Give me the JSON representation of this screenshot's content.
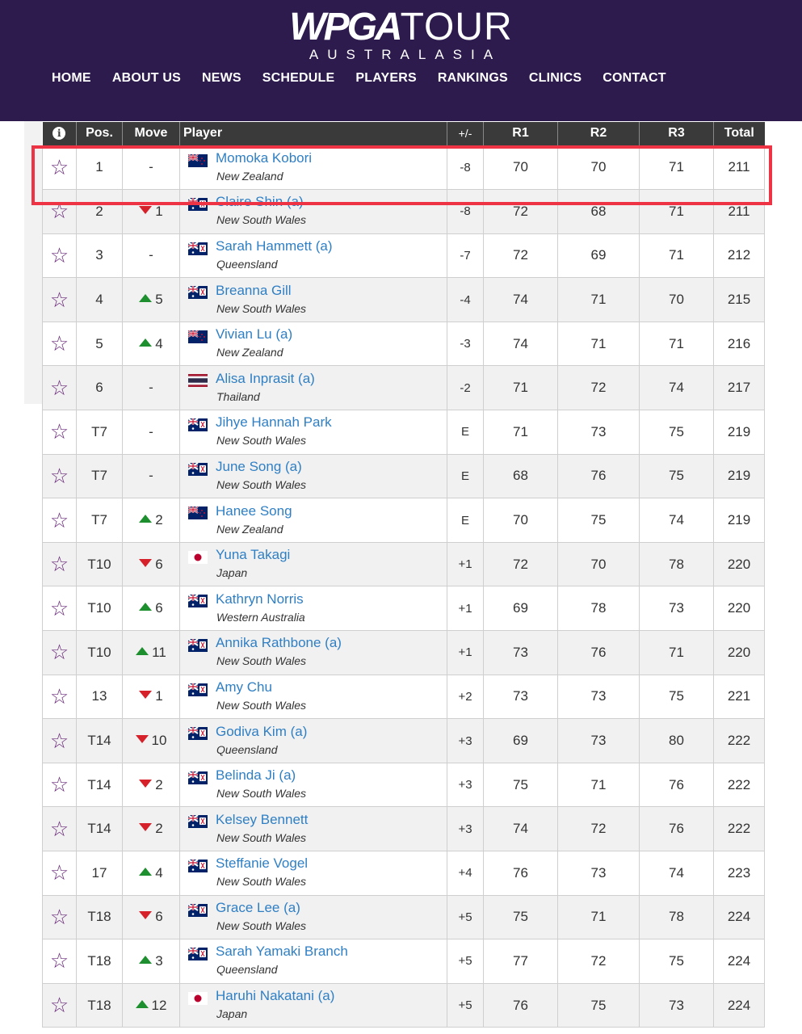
{
  "logo": {
    "bold": "WPGA",
    "thin": "TOUR",
    "sub": "AUSTRALASIA"
  },
  "nav": [
    "HOME",
    "ABOUT US",
    "NEWS",
    "SCHEDULE",
    "PLAYERS",
    "RANKINGS",
    "CLINICS",
    "CONTACT"
  ],
  "table": {
    "headers": {
      "info": "i",
      "pos": "Pos.",
      "move": "Move",
      "player": "Player",
      "pm": "+/-",
      "r1": "R1",
      "r2": "R2",
      "r3": "R3",
      "total": "Total"
    },
    "rows": [
      {
        "pos": "1",
        "move": "-",
        "dir": "none",
        "name": "Momoka Kobori",
        "region": "New Zealand",
        "flag": "nz",
        "pm": "-8",
        "r1": "70",
        "r2": "70",
        "r3": "71",
        "total": "211"
      },
      {
        "pos": "2",
        "move": "1",
        "dir": "down",
        "name": "Claire Shin (a)",
        "region": "New South Wales",
        "flag": "au",
        "pm": "-8",
        "r1": "72",
        "r2": "68",
        "r3": "71",
        "total": "211"
      },
      {
        "pos": "3",
        "move": "-",
        "dir": "none",
        "name": "Sarah Hammett (a)",
        "region": "Queensland",
        "flag": "au",
        "pm": "-7",
        "r1": "72",
        "r2": "69",
        "r3": "71",
        "total": "212"
      },
      {
        "pos": "4",
        "move": "5",
        "dir": "up",
        "name": "Breanna Gill",
        "region": "New South Wales",
        "flag": "au",
        "pm": "-4",
        "r1": "74",
        "r2": "71",
        "r3": "70",
        "total": "215"
      },
      {
        "pos": "5",
        "move": "4",
        "dir": "up",
        "name": "Vivian Lu (a)",
        "region": "New Zealand",
        "flag": "nz",
        "pm": "-3",
        "r1": "74",
        "r2": "71",
        "r3": "71",
        "total": "216"
      },
      {
        "pos": "6",
        "move": "-",
        "dir": "none",
        "name": "Alisa Inprasit (a)",
        "region": "Thailand",
        "flag": "th",
        "pm": "-2",
        "r1": "71",
        "r2": "72",
        "r3": "74",
        "total": "217"
      },
      {
        "pos": "T7",
        "move": "-",
        "dir": "none",
        "name": "Jihye Hannah Park",
        "region": "New South Wales",
        "flag": "au",
        "pm": "E",
        "r1": "71",
        "r2": "73",
        "r3": "75",
        "total": "219"
      },
      {
        "pos": "T7",
        "move": "-",
        "dir": "none",
        "name": "June Song (a)",
        "region": "New South Wales",
        "flag": "au",
        "pm": "E",
        "r1": "68",
        "r2": "76",
        "r3": "75",
        "total": "219"
      },
      {
        "pos": "T7",
        "move": "2",
        "dir": "up",
        "name": "Hanee Song",
        "region": "New Zealand",
        "flag": "nz",
        "pm": "E",
        "r1": "70",
        "r2": "75",
        "r3": "74",
        "total": "219"
      },
      {
        "pos": "T10",
        "move": "6",
        "dir": "down",
        "name": "Yuna Takagi",
        "region": "Japan",
        "flag": "jp",
        "pm": "+1",
        "r1": "72",
        "r2": "70",
        "r3": "78",
        "total": "220"
      },
      {
        "pos": "T10",
        "move": "6",
        "dir": "up",
        "name": "Kathryn Norris",
        "region": "Western Australia",
        "flag": "au",
        "pm": "+1",
        "r1": "69",
        "r2": "78",
        "r3": "73",
        "total": "220"
      },
      {
        "pos": "T10",
        "move": "11",
        "dir": "up",
        "name": "Annika Rathbone (a)",
        "region": "New South Wales",
        "flag": "au",
        "pm": "+1",
        "r1": "73",
        "r2": "76",
        "r3": "71",
        "total": "220"
      },
      {
        "pos": "13",
        "move": "1",
        "dir": "down",
        "name": "Amy Chu",
        "region": "New South Wales",
        "flag": "au",
        "pm": "+2",
        "r1": "73",
        "r2": "73",
        "r3": "75",
        "total": "221"
      },
      {
        "pos": "T14",
        "move": "10",
        "dir": "down",
        "name": "Godiva Kim (a)",
        "region": "Queensland",
        "flag": "au",
        "pm": "+3",
        "r1": "69",
        "r2": "73",
        "r3": "80",
        "total": "222"
      },
      {
        "pos": "T14",
        "move": "2",
        "dir": "down",
        "name": "Belinda Ji (a)",
        "region": "New South Wales",
        "flag": "au",
        "pm": "+3",
        "r1": "75",
        "r2": "71",
        "r3": "76",
        "total": "222"
      },
      {
        "pos": "T14",
        "move": "2",
        "dir": "down",
        "name": "Kelsey Bennett",
        "region": "New South Wales",
        "flag": "au",
        "pm": "+3",
        "r1": "74",
        "r2": "72",
        "r3": "76",
        "total": "222"
      },
      {
        "pos": "17",
        "move": "4",
        "dir": "up",
        "name": "Steffanie Vogel",
        "region": "New South Wales",
        "flag": "au",
        "pm": "+4",
        "r1": "76",
        "r2": "73",
        "r3": "74",
        "total": "223"
      },
      {
        "pos": "T18",
        "move": "6",
        "dir": "down",
        "name": "Grace Lee (a)",
        "region": "New South Wales",
        "flag": "au",
        "pm": "+5",
        "r1": "75",
        "r2": "71",
        "r3": "78",
        "total": "224"
      },
      {
        "pos": "T18",
        "move": "3",
        "dir": "up",
        "name": "Sarah Yamaki Branch",
        "region": "Queensland",
        "flag": "au",
        "pm": "+5",
        "r1": "77",
        "r2": "72",
        "r3": "75",
        "total": "224"
      },
      {
        "pos": "T18",
        "move": "12",
        "dir": "up",
        "name": "Haruhi Nakatani (a)",
        "region": "Japan",
        "flag": "jp",
        "pm": "+5",
        "r1": "76",
        "r2": "75",
        "r3": "73",
        "total": "224"
      }
    ]
  },
  "colors": {
    "header_bg": "#2d1b4e",
    "link": "#2f7fc4",
    "up": "#1e8f2e",
    "down": "#d6202a",
    "highlight": "#ee3344"
  }
}
